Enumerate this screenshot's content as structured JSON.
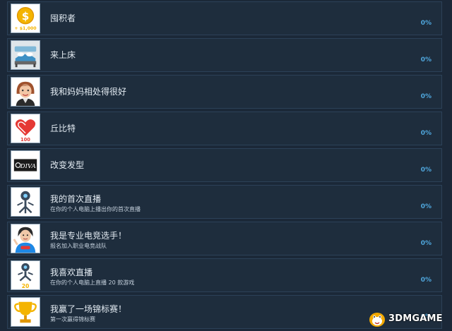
{
  "achievements": [
    {
      "title": "囤积者",
      "description": "",
      "percent": "0%",
      "icon": "money-coin-icon",
      "icon_caption": "+ $1,000"
    },
    {
      "title": "来上床",
      "description": "",
      "percent": "0%",
      "icon": "bed-icon"
    },
    {
      "title": "我和妈妈相处得很好",
      "description": "",
      "percent": "0%",
      "icon": "mom-avatar-icon"
    },
    {
      "title": "丘比特",
      "description": "",
      "percent": "0%",
      "icon": "heart-icon",
      "icon_caption": "100"
    },
    {
      "title": "改变发型",
      "description": "",
      "percent": "0%",
      "icon": "diva-logo-icon",
      "icon_caption": "DIVA"
    },
    {
      "title": "我的首次直播",
      "description": "在你的个人电脑上播出你的首次直播",
      "percent": "0%",
      "icon": "streaming-mascot-icon"
    },
    {
      "title": "我是专业电竞选手！",
      "description": "报名加入职业电竞战队",
      "percent": "0%",
      "icon": "gamer-avatar-icon"
    },
    {
      "title": "我喜欢直播",
      "description": "在你的个人电脑上直播 20 款游戏",
      "percent": "0%",
      "icon": "streaming-mascot-icon",
      "icon_caption": "20"
    },
    {
      "title": "我赢了一场锦标赛！",
      "description": "第一次赢得锦标赛",
      "percent": "0%",
      "icon": "trophy-icon"
    }
  ],
  "watermark": {
    "text": "3DMGAME",
    "icon": "mascot-logo-icon"
  },
  "colors": {
    "background": "#1b2838",
    "row_background": "#1e2d3d",
    "row_border": "#2c4158",
    "percent": "#4fa6dc",
    "title": "#e3ebf2"
  }
}
